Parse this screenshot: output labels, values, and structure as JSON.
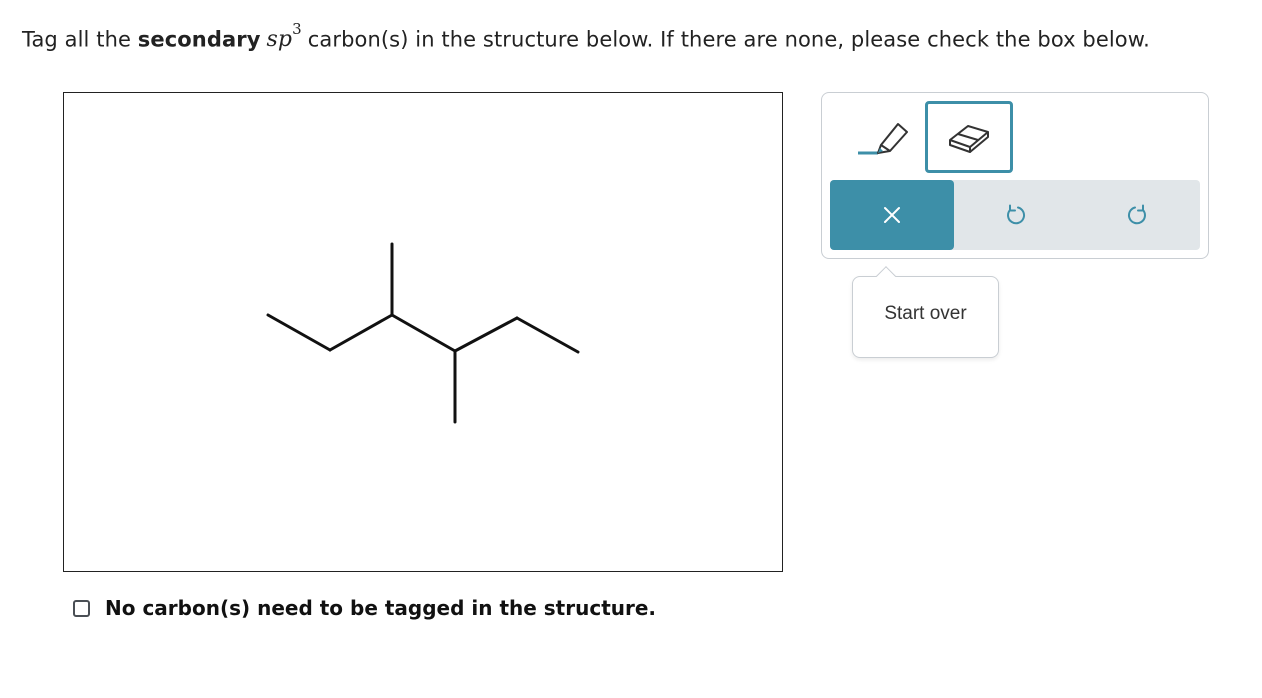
{
  "question": {
    "prefix": "Tag all the ",
    "emphasis": "secondary",
    "math_base": "sp",
    "math_exponent": "3",
    "suffix": "carbon(s) in the structure below. If there are none, please check the box below."
  },
  "toolbar": {
    "tag_tool_icon": "pencil-tag-icon",
    "eraser_tool_icon": "eraser-icon",
    "clear_icon": "close-icon",
    "undo_icon": "undo-icon",
    "redo_icon": "redo-icon",
    "accent_color": "#3d8fa8",
    "bar_color": "#e1e6e9"
  },
  "tooltip": {
    "text": "Start over"
  },
  "none_option": {
    "label": "No carbon(s) need to be tagged in the structure.",
    "checked": false
  }
}
